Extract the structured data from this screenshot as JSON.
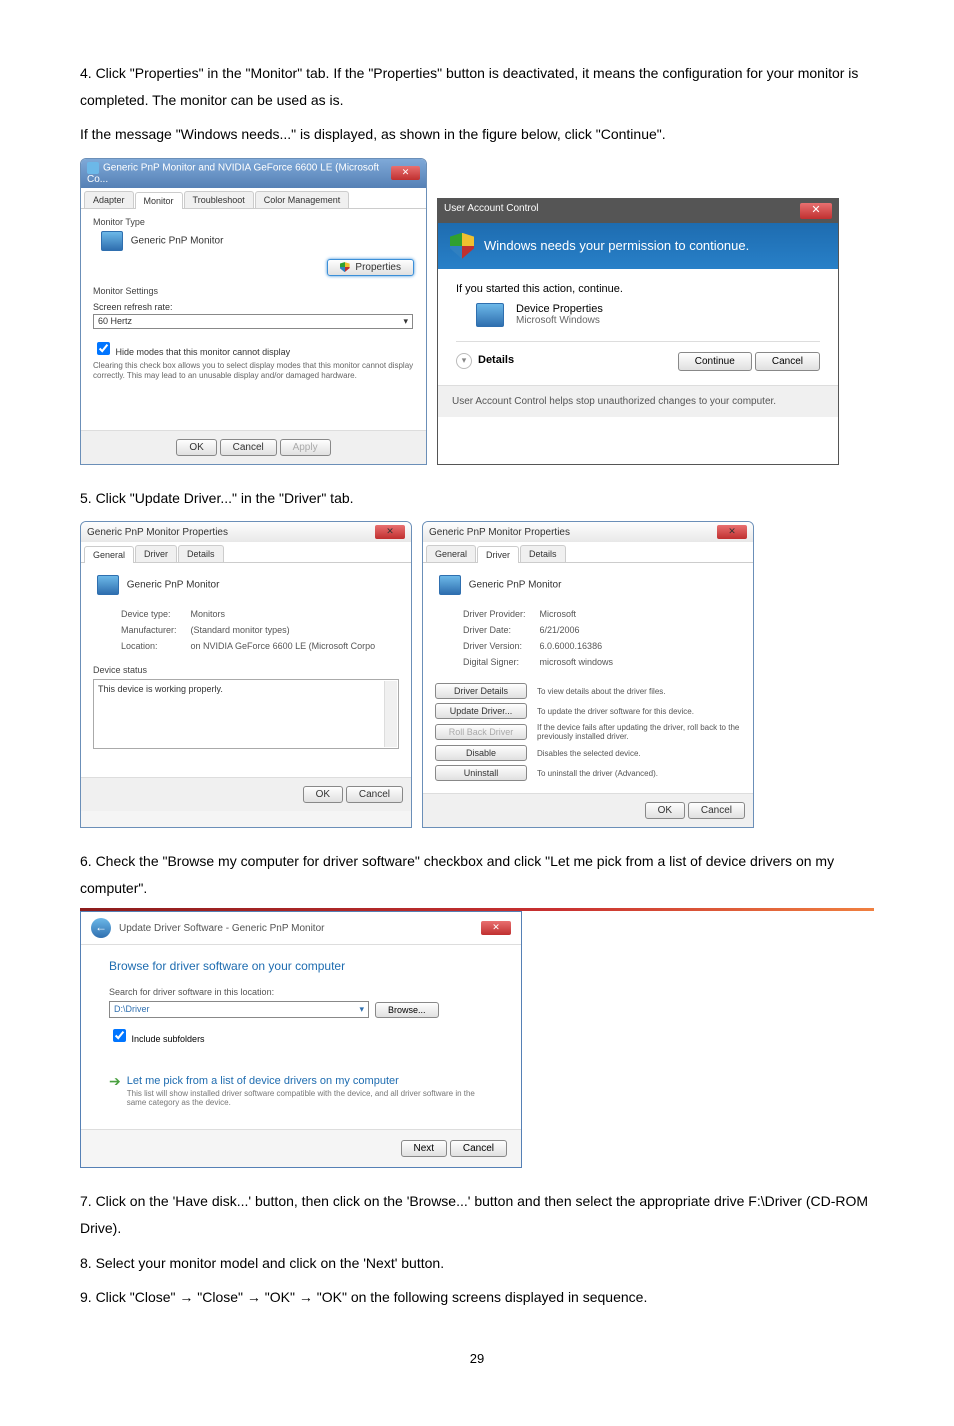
{
  "step4": {
    "line1": "4. Click \"Properties\" in the \"Monitor\" tab. If the \"Properties\" button is deactivated, it means the configuration for your monitor is completed. The monitor can be used as is.",
    "line2": "If the message \"Windows needs...\" is displayed, as shown in the figure below, click \"Continue\"."
  },
  "monitorDialog": {
    "title": "Generic PnP Monitor and NVIDIA GeForce 6600 LE (Microsoft Co...",
    "tabs": {
      "adapter": "Adapter",
      "monitor": "Monitor",
      "troubleshoot": "Troubleshoot",
      "color": "Color Management"
    },
    "monitorTypeLabel": "Monitor Type",
    "monitorName": "Generic PnP Monitor",
    "propertiesBtn": "Properties",
    "settingsLabel": "Monitor Settings",
    "refreshLabel": "Screen refresh rate:",
    "refreshValue": "60 Hertz",
    "hideModes": "Hide modes that this monitor cannot display",
    "hideModesHelp": "Clearing this check box allows you to select display modes that this monitor cannot display correctly. This may lead to an unusable display and/or damaged hardware.",
    "ok": "OK",
    "cancel": "Cancel",
    "apply": "Apply"
  },
  "uac": {
    "title": "User Account Control",
    "banner": "Windows needs your permission to contionue.",
    "actionLine": "If you started this action, continue.",
    "devProp": "Device Properties",
    "msWin": "Microsoft Windows",
    "details": "Details",
    "continue": "Continue",
    "cancel": "Cancel",
    "footer": "User Account Control helps stop unauthorized changes to your computer."
  },
  "step5": "5. Click \"Update Driver...\" in the \"Driver\" tab.",
  "propsGeneral": {
    "title": "Generic PnP Monitor Properties",
    "tabs": {
      "general": "General",
      "driver": "Driver",
      "details": "Details"
    },
    "monitorName": "Generic PnP Monitor",
    "deviceTypeLabel": "Device type:",
    "deviceType": "Monitors",
    "manufacturerLabel": "Manufacturer:",
    "manufacturer": "(Standard monitor types)",
    "locationLabel": "Location:",
    "location": "on NVIDIA GeForce 6600 LE (Microsoft Corpo",
    "deviceStatusLabel": "Device status",
    "deviceStatus": "This device is working properly.",
    "ok": "OK",
    "cancel": "Cancel"
  },
  "propsDriver": {
    "title": "Generic PnP Monitor Properties",
    "monitorName": "Generic PnP Monitor",
    "providerLabel": "Driver Provider:",
    "provider": "Microsoft",
    "dateLabel": "Driver Date:",
    "date": "6/21/2006",
    "versionLabel": "Driver Version:",
    "version": "6.0.6000.16386",
    "signerLabel": "Digital Signer:",
    "signer": "microsoft windows",
    "btnDetails": "Driver Details",
    "descDetails": "To view details about the driver files.",
    "btnUpdate": "Update Driver...",
    "descUpdate": "To update the driver software for this device.",
    "btnRollback": "Roll Back Driver",
    "descRollback": "If the device fails after updating the driver, roll back to the previously installed driver.",
    "btnDisable": "Disable",
    "descDisable": "Disables the selected device.",
    "btnUninstall": "Uninstall",
    "descUninstall": "To uninstall the driver (Advanced).",
    "ok": "OK",
    "cancel": "Cancel"
  },
  "step6": "6. Check the \"Browse my computer for driver software\" checkbox and click \"Let me pick from a list of device drivers on my computer\".",
  "wizard": {
    "title": "Update Driver Software - Generic PnP Monitor",
    "heading": "Browse for driver software on your computer",
    "searchLabel": "Search for driver software in this location:",
    "pathValue": "D:\\Driver",
    "browse": "Browse...",
    "includeSub": "Include subfolders",
    "pickOption": "Let me pick from a list of device drivers on my computer",
    "pickHelp": "This list will show installed driver software compatible with the device, and all driver software in the same category as the device.",
    "next": "Next",
    "cancel": "Cancel"
  },
  "step7": "7. Click on the 'Have disk...' button, then click on the 'Browse...' button and then select the appropriate drive F:\\Driver (CD-ROM Drive).",
  "step8": "8. Select your monitor model and click on the 'Next' button.",
  "step9": "9. Click \"Close\"  →  \"Close\"  →  \"OK\"  →  \"OK\" on the following screens displayed in sequence.",
  "pageNum": "29"
}
